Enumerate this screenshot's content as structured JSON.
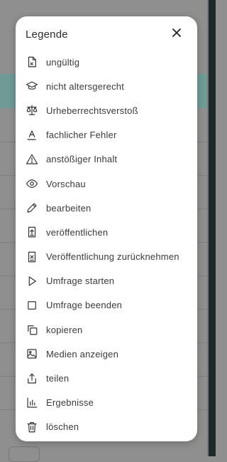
{
  "colors": {
    "overlay": "#8f8f8f",
    "text": "#3a3a3a",
    "icon": "#333333"
  },
  "legend": {
    "title": "Legende",
    "close_icon": "close-icon",
    "items": [
      {
        "icon": "file-x-icon",
        "label": "ungültig"
      },
      {
        "icon": "graduation-cap-icon",
        "label": "nicht altersgerecht"
      },
      {
        "icon": "scale-icon",
        "label": "Urheberrechtsverstoß"
      },
      {
        "icon": "spell-check-icon",
        "label": "fachlicher Fehler"
      },
      {
        "icon": "warning-triangle-icon",
        "label": "anstößiger Inhalt"
      },
      {
        "icon": "eye-icon",
        "label": "Vorschau"
      },
      {
        "icon": "pencil-icon",
        "label": "bearbeiten"
      },
      {
        "icon": "publish-icon",
        "label": "veröffentlichen"
      },
      {
        "icon": "unpublish-icon",
        "label": "Veröffentlichung zurücknehmen"
      },
      {
        "icon": "play-icon",
        "label": "Umfrage starten"
      },
      {
        "icon": "stop-square-icon",
        "label": "Umfrage beenden"
      },
      {
        "icon": "copy-icon",
        "label": "kopieren"
      },
      {
        "icon": "image-icon",
        "label": "Medien anzeigen"
      },
      {
        "icon": "share-icon",
        "label": "teilen"
      },
      {
        "icon": "bar-chart-icon",
        "label": "Ergebnisse"
      },
      {
        "icon": "trash-icon",
        "label": "löschen"
      }
    ]
  }
}
